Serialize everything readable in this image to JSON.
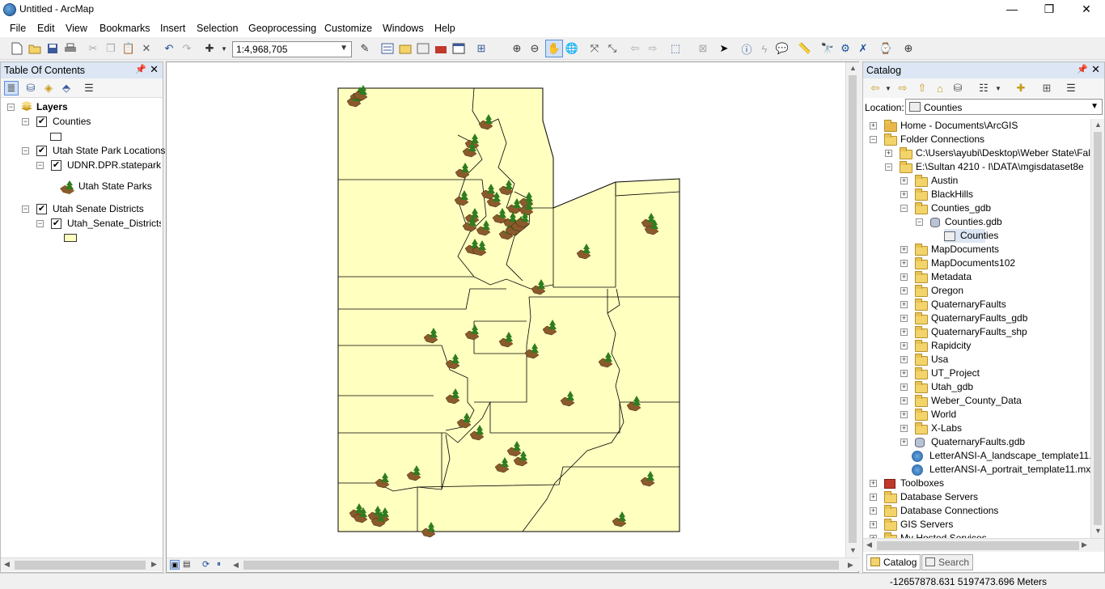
{
  "window": {
    "title": "Untitled - ArcMap",
    "minimize": "—",
    "restore": "❐",
    "close": "✕"
  },
  "menu": [
    "File",
    "Edit",
    "View",
    "Bookmarks",
    "Insert",
    "Selection",
    "Geoprocessing",
    "Customize",
    "Windows",
    "Help"
  ],
  "toolbar": {
    "scale": "1:4,968,705"
  },
  "toc": {
    "title": "Table Of Contents",
    "layers_label": "Layers",
    "counties": "Counties",
    "parks_group": "Utah State Park Locations",
    "parks_layer": "UDNR.DPR.stateparkw",
    "parks_legend": "Utah State Parks",
    "senate_group": "Utah Senate Districts",
    "senate_layer": "Utah_Senate_Districts"
  },
  "catalog": {
    "title": "Catalog",
    "location_label": "Location:",
    "location_value": "Counties",
    "tree": {
      "home": "Home - Documents\\ArcGIS",
      "folder_connections": "Folder Connections",
      "conn_c": "C:\\Users\\ayubi\\Desktop\\Weber State\\Fal",
      "conn_e": "E:\\Sultan 4210 - I\\DATA\\mgisdataset8e",
      "folders": [
        "Austin",
        "BlackHills",
        "Counties_gdb"
      ],
      "counties_gdb": "Counties.gdb",
      "counties_fc": "Counties",
      "folders2": [
        "MapDocuments",
        "MapDocuments102",
        "Metadata",
        "Oregon",
        "QuaternaryFaults",
        "QuaternaryFaults_gdb",
        "QuaternaryFaults_shp",
        "Rapidcity",
        "Usa",
        "UT_Project",
        "Utah_gdb",
        "Weber_County_Data",
        "World",
        "X-Labs"
      ],
      "qf_gdb": "QuaternaryFaults.gdb",
      "mxd1": "LetterANSI-A_landscape_template11.",
      "mxd2": "LetterANSI-A_portrait_template11.mx",
      "toolboxes": "Toolboxes",
      "db_servers": "Database Servers",
      "db_connections": "Database Connections",
      "gis_servers": "GIS Servers",
      "hosted": "My Hosted Services"
    },
    "tab_catalog": "Catalog",
    "tab_search": "Search"
  },
  "status": {
    "coords": "-12657878.631  5197473.696 Meters"
  },
  "colors": {
    "map_fill": "#ffffc0",
    "panel_head": "#dce6f4",
    "park_icon": "#8b5a2b"
  }
}
